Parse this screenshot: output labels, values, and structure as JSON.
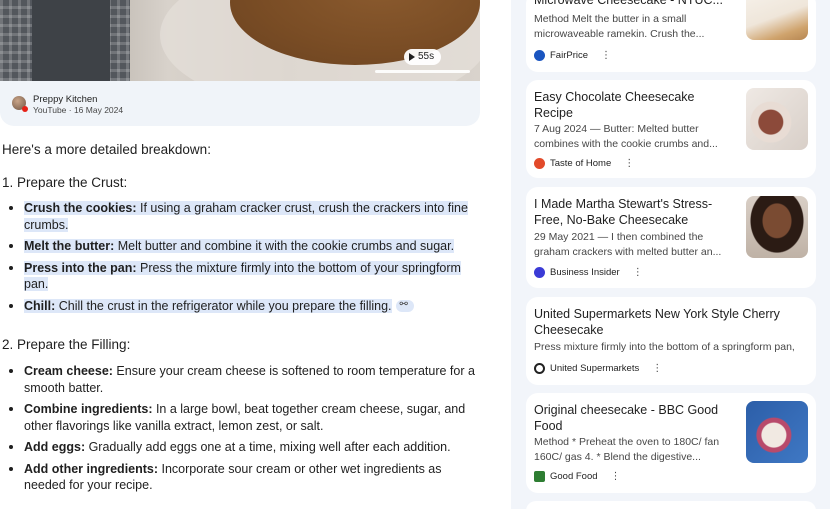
{
  "video": {
    "duration": "55s",
    "channel": "Preppy Kitchen",
    "meta": "YouTube · 16 May 2024"
  },
  "answer": {
    "intro": "Here's a more detailed breakdown:",
    "sections": [
      {
        "heading": "1. Prepare the Crust:",
        "items": [
          {
            "term": "Crush the cookies:",
            "text": " If using a graham cracker crust, crush the crackers into fine crumbs."
          },
          {
            "term": "Melt the butter:",
            "text": " Melt butter and combine it with the cookie crumbs and sugar."
          },
          {
            "term": "Press into the pan:",
            "text": " Press the mixture firmly into the bottom of your springform pan."
          },
          {
            "term": "Chill:",
            "text": " Chill the crust in the refrigerator while you prepare the filling."
          }
        ]
      },
      {
        "heading": "2. Prepare the Filling:",
        "items": [
          {
            "term": "Cream cheese:",
            "text": " Ensure your cream cheese is softened to room temperature for a smooth batter."
          },
          {
            "term": "Combine ingredients:",
            "text": " In a large bowl, beat together cream cheese, sugar, and other flavorings like vanilla extract, lemon zest, or salt."
          },
          {
            "term": "Add eggs:",
            "text": " Gradually add eggs one at a time, mixing well after each addition."
          },
          {
            "term": "Add other ingredients:",
            "text": " Incorporate sour cream or other wet ingredients as needed for your recipe."
          }
        ]
      }
    ]
  },
  "sources": [
    {
      "title": "Microwave Cheesecake - NTUC...",
      "snippet": "Method Melt the butter in a small microwaveable ramekin. Crush the...",
      "site": "FairPrice",
      "color": "#1a55c0"
    },
    {
      "title": "Easy Chocolate Cheesecake Recipe",
      "snippet": "7 Aug 2024 — Butter: Melted butter combines with the cookie crumbs and...",
      "site": "Taste of Home",
      "color": "#e24a2a"
    },
    {
      "title": "I Made Martha Stewart's Stress-Free, No-Bake Cheesecake",
      "snippet": "29 May 2021 — I then combined the graham crackers with melted butter an...",
      "site": "Business Insider",
      "color": "#3b3bd6"
    },
    {
      "title": "United Supermarkets New York Style Cherry Cheesecake",
      "snippet": "Press mixture firmly into the bottom of a springform pan,",
      "site": "United Supermarkets",
      "color": "#222222"
    },
    {
      "title": "Original cheesecake - BBC Good Food",
      "snippet": "Method * Preheat the oven to 180C/ fan 160C/ gas 4. * Blend the digestive...",
      "site": "Good Food",
      "color": "#2e7d32"
    }
  ],
  "icons": {
    "more": "three-dots-vertical",
    "link": "link-icon",
    "play": "play-icon"
  }
}
